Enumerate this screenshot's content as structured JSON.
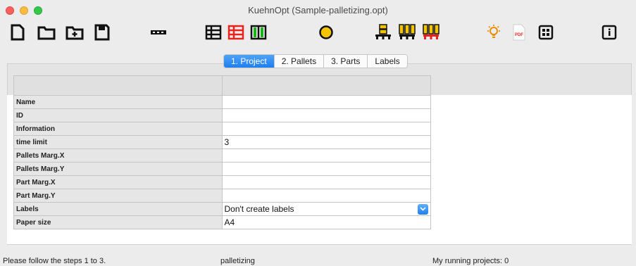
{
  "window": {
    "title": "KuehnOpt (Sample-palletizing.opt)"
  },
  "toolbar": {
    "icons": [
      "new-document-icon",
      "open-folder-icon",
      "new-folder-icon",
      "save-icon",
      "separator-icon",
      "table-icon",
      "table-red-icon",
      "columns-green-icon",
      "circle-yellow-icon",
      "stack-yellow-icon",
      "pallet-yellow-icon",
      "pallet-red-icon",
      "lightbulb-icon",
      "pdf-icon",
      "grid-icon",
      "info-icon"
    ],
    "pdf_label": "PDF"
  },
  "tabs": [
    {
      "label": "1. Project",
      "active": true
    },
    {
      "label": "2. Pallets",
      "active": false
    },
    {
      "label": "3. Parts",
      "active": false
    },
    {
      "label": "Labels",
      "active": false
    }
  ],
  "rows": [
    {
      "label": "Name",
      "value": ""
    },
    {
      "label": "ID",
      "value": ""
    },
    {
      "label": "Information",
      "value": ""
    },
    {
      "label": "time limit",
      "value": "3"
    },
    {
      "label": "Pallets Marg.X",
      "value": ""
    },
    {
      "label": "Pallets Marg.Y",
      "value": ""
    },
    {
      "label": "Part Marg.X",
      "value": ""
    },
    {
      "label": "Part Marg.Y",
      "value": ""
    },
    {
      "label": "Labels",
      "value": "Don't create labels"
    },
    {
      "label": "Paper size",
      "value": "A4"
    }
  ],
  "status": {
    "left": "Please follow the steps 1 to 3.",
    "middle": "palletizing",
    "right": "My running projects: 0"
  },
  "colors": {
    "accent": "#1f7ff0",
    "yellow": "#f5c400",
    "red": "#e8231d",
    "green": "#1bb31b"
  }
}
